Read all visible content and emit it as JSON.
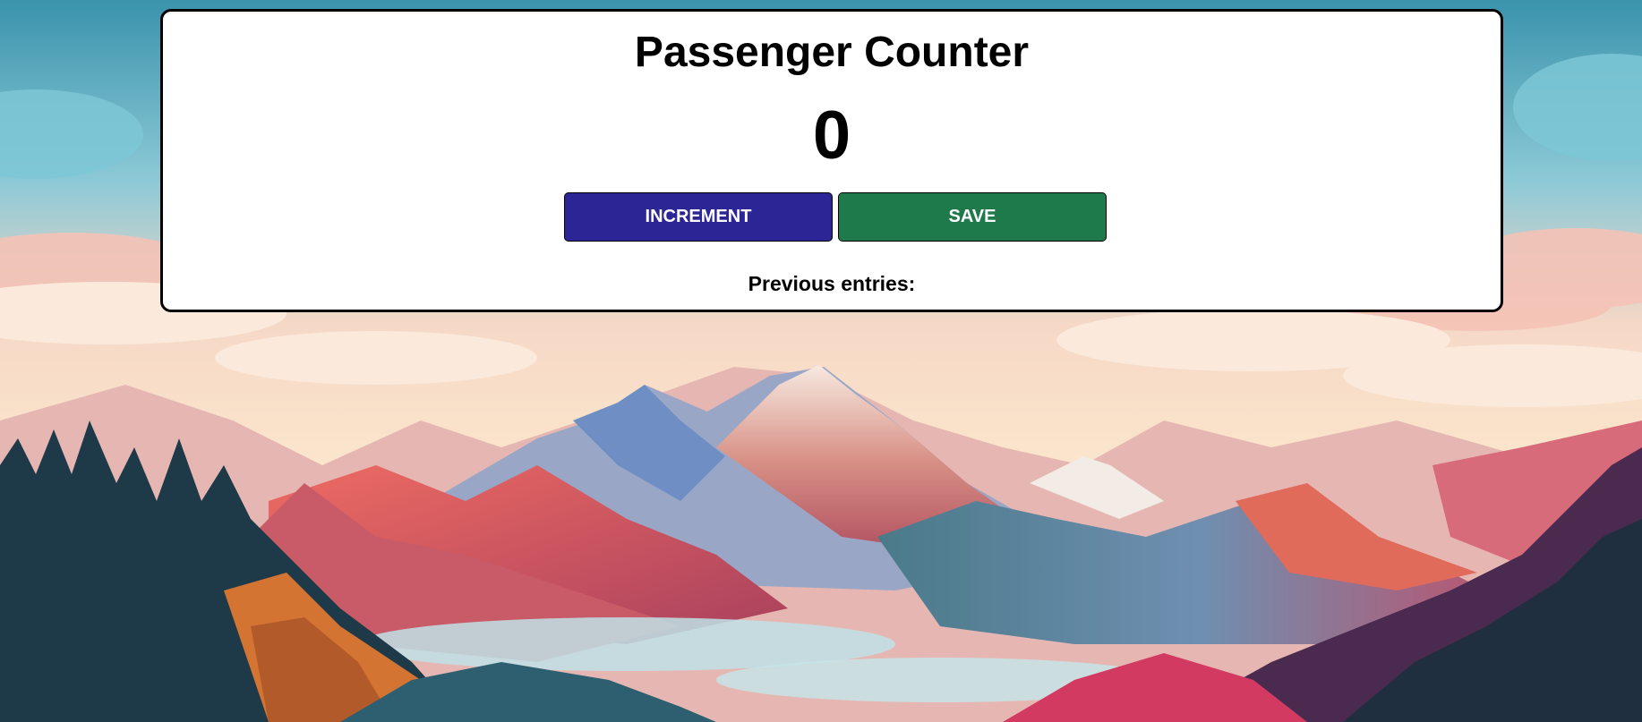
{
  "app": {
    "title": "Passenger Counter",
    "count": "0",
    "previous_entries_label": "Previous entries:"
  },
  "buttons": {
    "increment_label": "INCREMENT",
    "save_label": "SAVE"
  },
  "colors": {
    "increment": "#2b2595",
    "save": "#1e7a4a",
    "card_bg": "#ffffff",
    "card_border": "#000000"
  },
  "background": {
    "subject": "illustrated mountain landscape at sunrise"
  }
}
